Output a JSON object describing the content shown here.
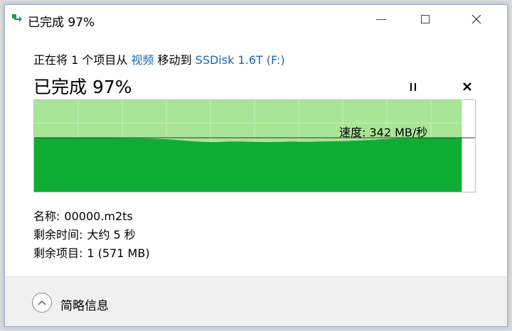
{
  "window": {
    "title": "已完成 97%"
  },
  "transfer": {
    "prefix": "正在将 1 个项目从 ",
    "source": "视频",
    "middle": " 移动到 ",
    "destination": "SSDisk 1.6T (F:)"
  },
  "progress": {
    "label": "已完成 97%",
    "percent": 97
  },
  "speed": {
    "text": "速度: 342 MB/秒",
    "samples": [
      0.995,
      0.997,
      0.995,
      0.995,
      0.994,
      0.995,
      0.993,
      0.992,
      0.99,
      0.985,
      0.975,
      0.96,
      0.94,
      0.925,
      0.92,
      0.93,
      0.93,
      0.925,
      0.92,
      0.925,
      0.93,
      0.925,
      0.93,
      0.935,
      0.94,
      0.95,
      0.96,
      0.975,
      0.99,
      0.995,
      0.995,
      0.994,
      0.995,
      0.995
    ]
  },
  "details": {
    "name_label": "名称:",
    "name_value": "00000.m2ts",
    "time_label": "剩余时间:",
    "time_value": "大约 5 秒",
    "items_label": "剩余项目:",
    "items_value": "1 (571 MB)"
  },
  "footer": {
    "toggle_label": "简略信息"
  },
  "colors": {
    "graph_fill": "#0dad34",
    "graph_progress_bg": "#a8e597",
    "link": "#1a66b5"
  },
  "icons": {
    "app": "copy-move-icon",
    "minimize": "minimize-icon",
    "maximize": "maximize-icon",
    "close": "close-icon",
    "pause": "pause-icon",
    "cancel": "cancel-icon",
    "chevron": "chevron-up-icon"
  }
}
